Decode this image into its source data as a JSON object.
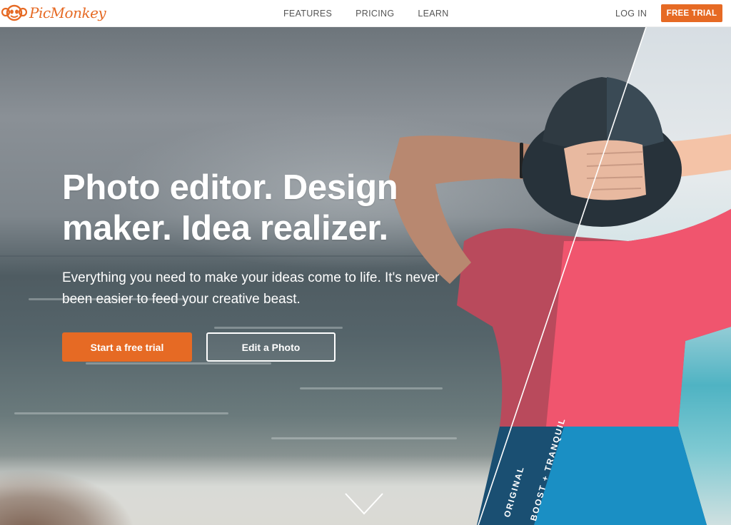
{
  "header": {
    "logo_text": "PicMonkey",
    "nav": [
      {
        "label": "FEATURES"
      },
      {
        "label": "PRICING"
      },
      {
        "label": "LEARN"
      }
    ],
    "login_label": "LOG IN",
    "free_trial_label": "FREE TRIAL"
  },
  "hero": {
    "headline": "Photo editor. Design maker. Idea realizer.",
    "subtext": "Everything you need to make your ideas come to life. It's never been easier to feed your creative beast.",
    "primary_button": "Start a free trial",
    "secondary_button": "Edit a Photo",
    "label_original": "ORIGINAL",
    "label_boost": "BOOST + TRANQUIL",
    "scroll_icon": "chevron-down-icon"
  },
  "colors": {
    "accent": "#e66a24",
    "text_on_dark": "#ffffff",
    "nav_text": "#555555"
  }
}
